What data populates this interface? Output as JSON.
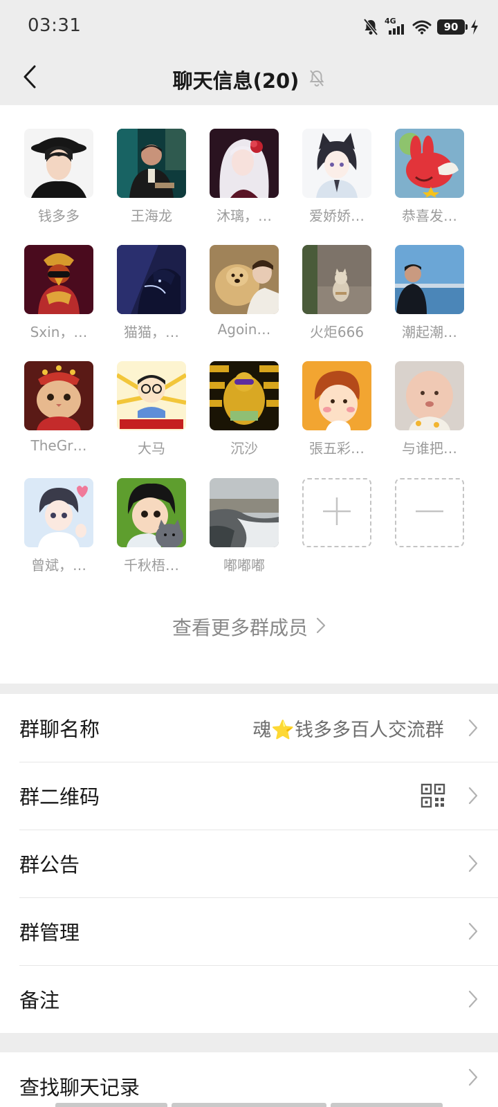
{
  "status_bar": {
    "time": "03:31",
    "network": "4G",
    "battery": "90"
  },
  "nav": {
    "title": "聊天信息(20)"
  },
  "members": [
    {
      "name": "钱多多"
    },
    {
      "name": "王海龙"
    },
    {
      "name": "沐璃，…"
    },
    {
      "name": "爱娇娇…"
    },
    {
      "name": "恭喜发…"
    },
    {
      "name": "Sxin，…"
    },
    {
      "name": "猫猫，…"
    },
    {
      "name": "Agoin…"
    },
    {
      "name": "火炬666"
    },
    {
      "name": "潮起潮…"
    },
    {
      "name": "TheGr…"
    },
    {
      "name": "大马"
    },
    {
      "name": "沉沙"
    },
    {
      "name": "張五彩…"
    },
    {
      "name": "与谁把…"
    },
    {
      "name": "曾斌，…"
    },
    {
      "name": "千秋梧…"
    },
    {
      "name": "嘟嘟嘟"
    }
  ],
  "see_more": "查看更多群成员",
  "settings": {
    "group_name_label": "群聊名称",
    "group_name_value": "魂⭐钱多多百人交流群",
    "qr_label": "群二维码",
    "announcement_label": "群公告",
    "manage_label": "群管理",
    "remark_label": "备注",
    "search_label": "查找聊天记录"
  }
}
